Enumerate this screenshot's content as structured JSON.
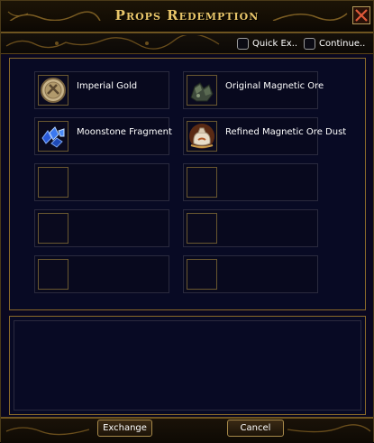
{
  "window": {
    "title": "Props Redemption"
  },
  "options": [
    {
      "label": "Quick Ex..",
      "checked": false
    },
    {
      "label": "Continue..",
      "checked": false
    }
  ],
  "items": [
    {
      "label": "Imperial Gold",
      "icon": "imperial-gold-coin-icon"
    },
    {
      "label": "Original Magnetic Ore",
      "icon": "magnetic-ore-icon"
    },
    {
      "label": "Moonstone Fragment",
      "icon": "moonstone-fragment-icon"
    },
    {
      "label": "Refined Magnetic Ore Dust",
      "icon": "ore-dust-sack-icon"
    }
  ],
  "buttons": {
    "exchange": "Exchange",
    "cancel": "Cancel"
  },
  "colors": {
    "title": "#e9c66a",
    "frame": "#8a6a2a",
    "panel": "#080a24"
  }
}
